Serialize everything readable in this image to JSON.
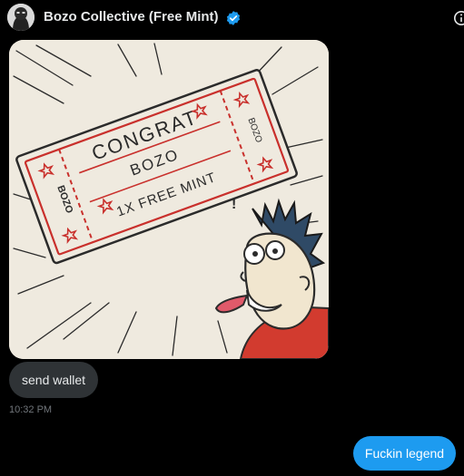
{
  "header": {
    "title": "Bozo Collective (Free Mint)",
    "avatar_icon": "masked-figure-avatar",
    "verified_icon": "verified-badge-icon",
    "info_icon": "info-icon"
  },
  "media": {
    "ticket_line1": "CONGRAT",
    "ticket_line2": "BOZO",
    "ticket_line3": "1X FREE MINT",
    "stub_left": "BOZO",
    "stub_right": "BOZO",
    "speech_mark": "!"
  },
  "messages": {
    "incoming_text": "send wallet",
    "incoming_time": "10:32 PM",
    "outgoing_text": "Fuckin legend"
  },
  "colors": {
    "background": "#000000",
    "incoming_bubble": "#2f3336",
    "outgoing_bubble": "#1d9bf0",
    "verified": "#1d9bf0",
    "ticket_red": "#c9302c",
    "paper": "#efeadf"
  }
}
